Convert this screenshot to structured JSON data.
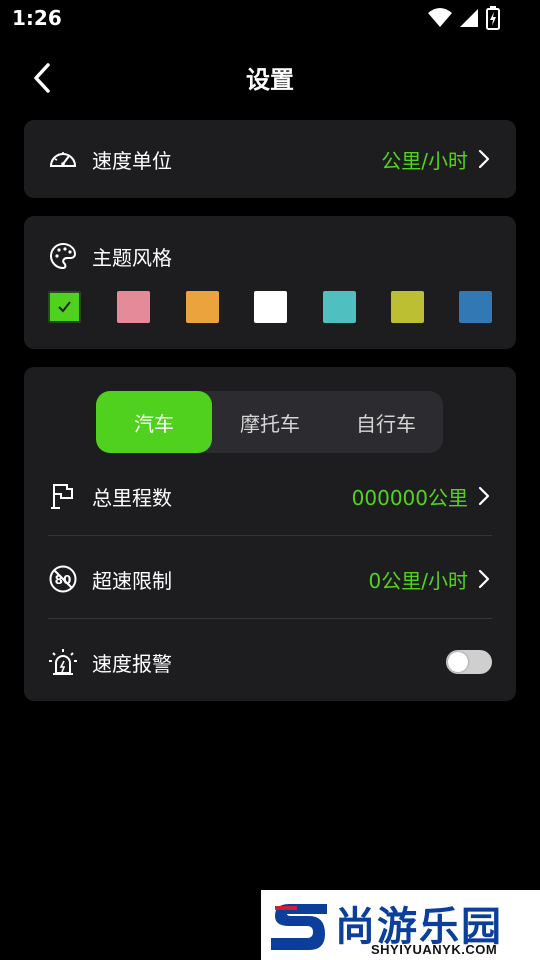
{
  "status_bar": {
    "time": "1:26",
    "icons": [
      "wifi-icon",
      "signal-icon",
      "battery-charging-icon"
    ]
  },
  "app_bar": {
    "title": "设置",
    "back_icon": "back-arrow-icon"
  },
  "speed_unit": {
    "label": "速度单位",
    "value": "公里/小时",
    "icon": "speedometer-icon"
  },
  "theme": {
    "label": "主题风格",
    "icon": "palette-icon",
    "selected_index": 0,
    "swatches": [
      "#4fd11d",
      "#e58a98",
      "#eba43d",
      "#ffffff",
      "#4fbfbf",
      "#bdbf33",
      "#3278b4"
    ]
  },
  "vehicle_tabs": {
    "items": [
      "汽车",
      "摩托车",
      "自行车"
    ],
    "active_index": 0,
    "accent": "#4fd11d"
  },
  "mileage": {
    "label": "总里程数",
    "value": "000000公里",
    "icon": "flag-icon"
  },
  "overspeed": {
    "label": "超速限制",
    "value": "0公里/小时",
    "icon": "speed-limit-icon"
  },
  "alarm": {
    "label": "速度报警",
    "icon": "alarm-light-icon",
    "enabled": false
  },
  "watermark": {
    "brand": "尚游乐园",
    "url": "SHYIYUANYK.COM"
  }
}
